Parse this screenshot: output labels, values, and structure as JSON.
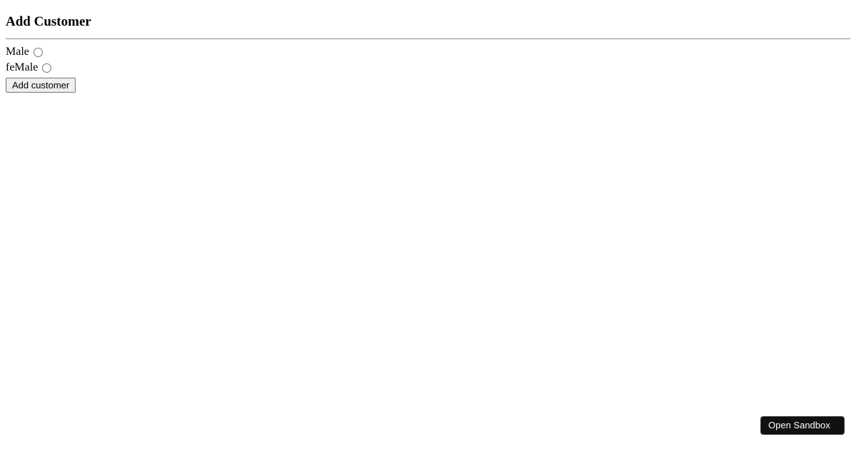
{
  "page": {
    "title": "Add Customer"
  },
  "form": {
    "gender_options": [
      {
        "label": "Male"
      },
      {
        "label": "feMale"
      }
    ],
    "submit_label": "Add customer"
  },
  "overlay": {
    "open_sandbox": "Open Sandbox"
  }
}
